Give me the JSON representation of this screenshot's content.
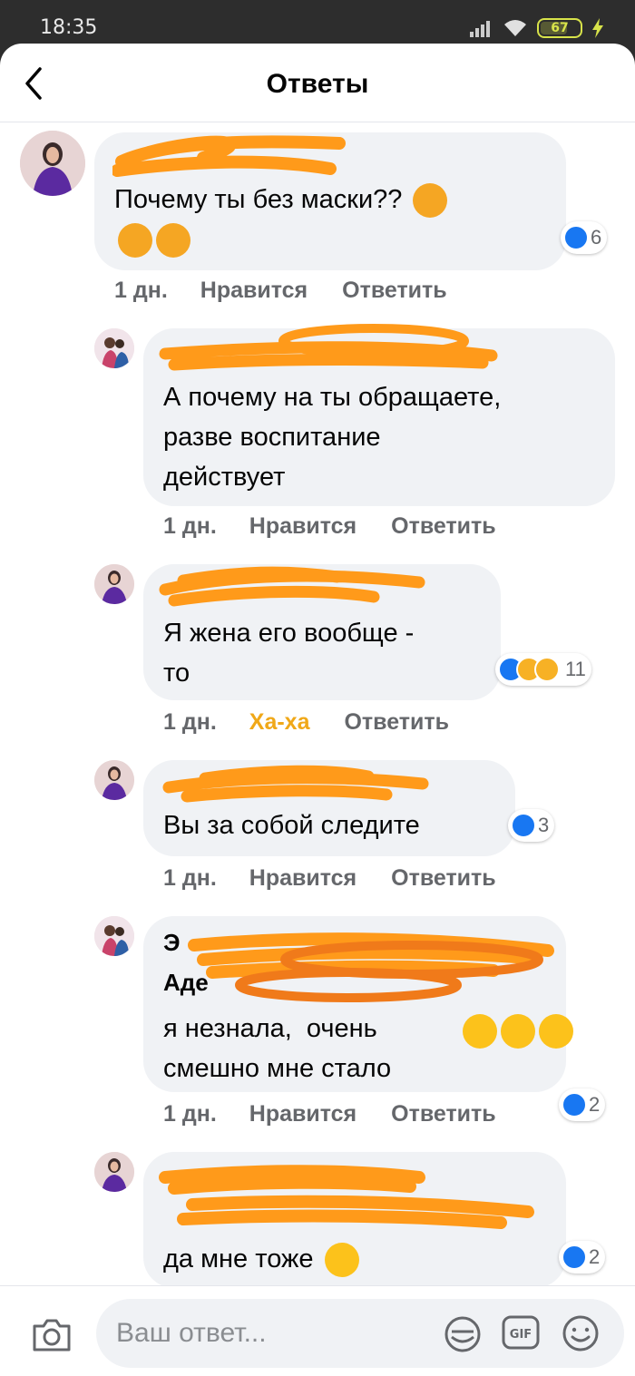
{
  "status_bar": {
    "time": "18:35",
    "battery": "67"
  },
  "header": {
    "title": "Ответы"
  },
  "comments": [
    {
      "text": "Почему ты без маски??",
      "time": "1 дн.",
      "like": "Нравится",
      "reply": "Ответить",
      "reactions": "6",
      "reaction_icons": [
        "like-icon"
      ],
      "emoji": [
        "angry-face-emoji",
        "angry-face-emoji",
        "angry-face-emoji"
      ]
    },
    {
      "text": "А почему на ты обращаете,\nразве воспитание\nдействует",
      "time": "1 дн.",
      "like": "Нравится",
      "reply": "Ответить"
    },
    {
      "text": "Я жена его вообще -\nто",
      "time": "1 дн.",
      "like": "Ха-ха",
      "reply": "Ответить",
      "reactions": "11",
      "reaction_icons": [
        "like-icon",
        "haha-icon",
        "care-icon"
      ]
    },
    {
      "text": "Вы за собой следите",
      "time": "1 дн.",
      "like": "Нравится",
      "reply": "Ответить",
      "reactions": "3",
      "reaction_icons": [
        "like-icon"
      ]
    },
    {
      "author_first": "Э",
      "author_second": "Аде",
      "text": "я незнала,  очень\nсмешно мне стало",
      "time": "1 дн.",
      "like": "Нравится",
      "reply": "Ответить",
      "reactions": "2",
      "reaction_icons": [
        "like-icon"
      ],
      "emoji": [
        "grinning-face-emoji",
        "grinning-face-emoji",
        "grinning-face-emoji"
      ]
    },
    {
      "text": "да мне тоже",
      "reactions": "2",
      "reaction_icons": [
        "like-icon"
      ],
      "emoji": [
        "beaming-face-emoji"
      ]
    }
  ],
  "composer": {
    "placeholder": "Ваш ответ..."
  },
  "colors": {
    "bubble": "#f0f2f5",
    "like_blue": "#1877f2",
    "haha_orange": "#f0a818",
    "meta_gray": "#65676b",
    "redaction_orange": "#ff9a1a"
  }
}
